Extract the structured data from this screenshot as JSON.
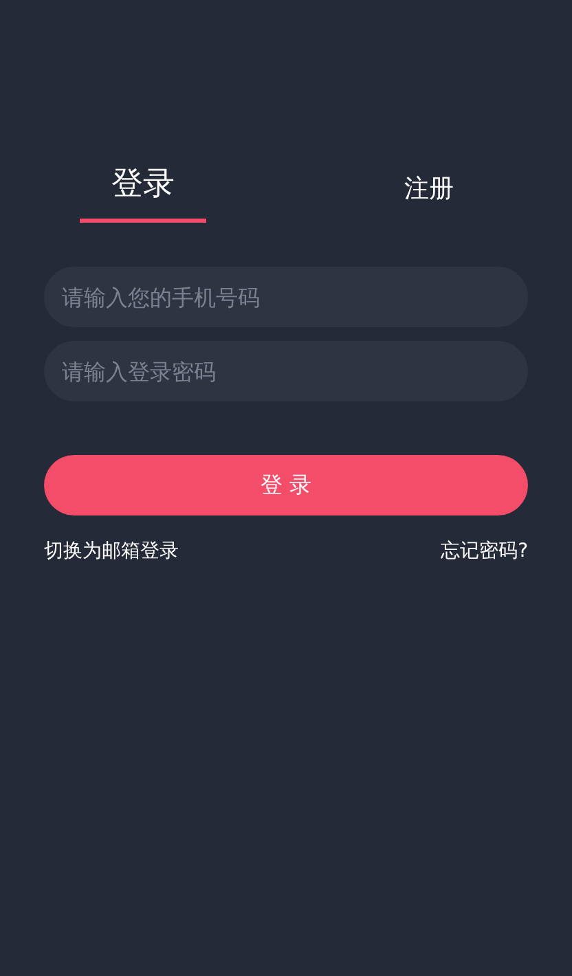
{
  "tabs": [
    {
      "label": "登录",
      "selected": true
    },
    {
      "label": "注册",
      "selected": false
    }
  ],
  "fields": [
    {
      "placeholder": "请输入您的手机号码"
    },
    {
      "placeholder": "请输入登录密码"
    }
  ],
  "submit": "登 录",
  "links": {
    "left": "切换为邮箱登录",
    "right": "忘记密码?"
  }
}
